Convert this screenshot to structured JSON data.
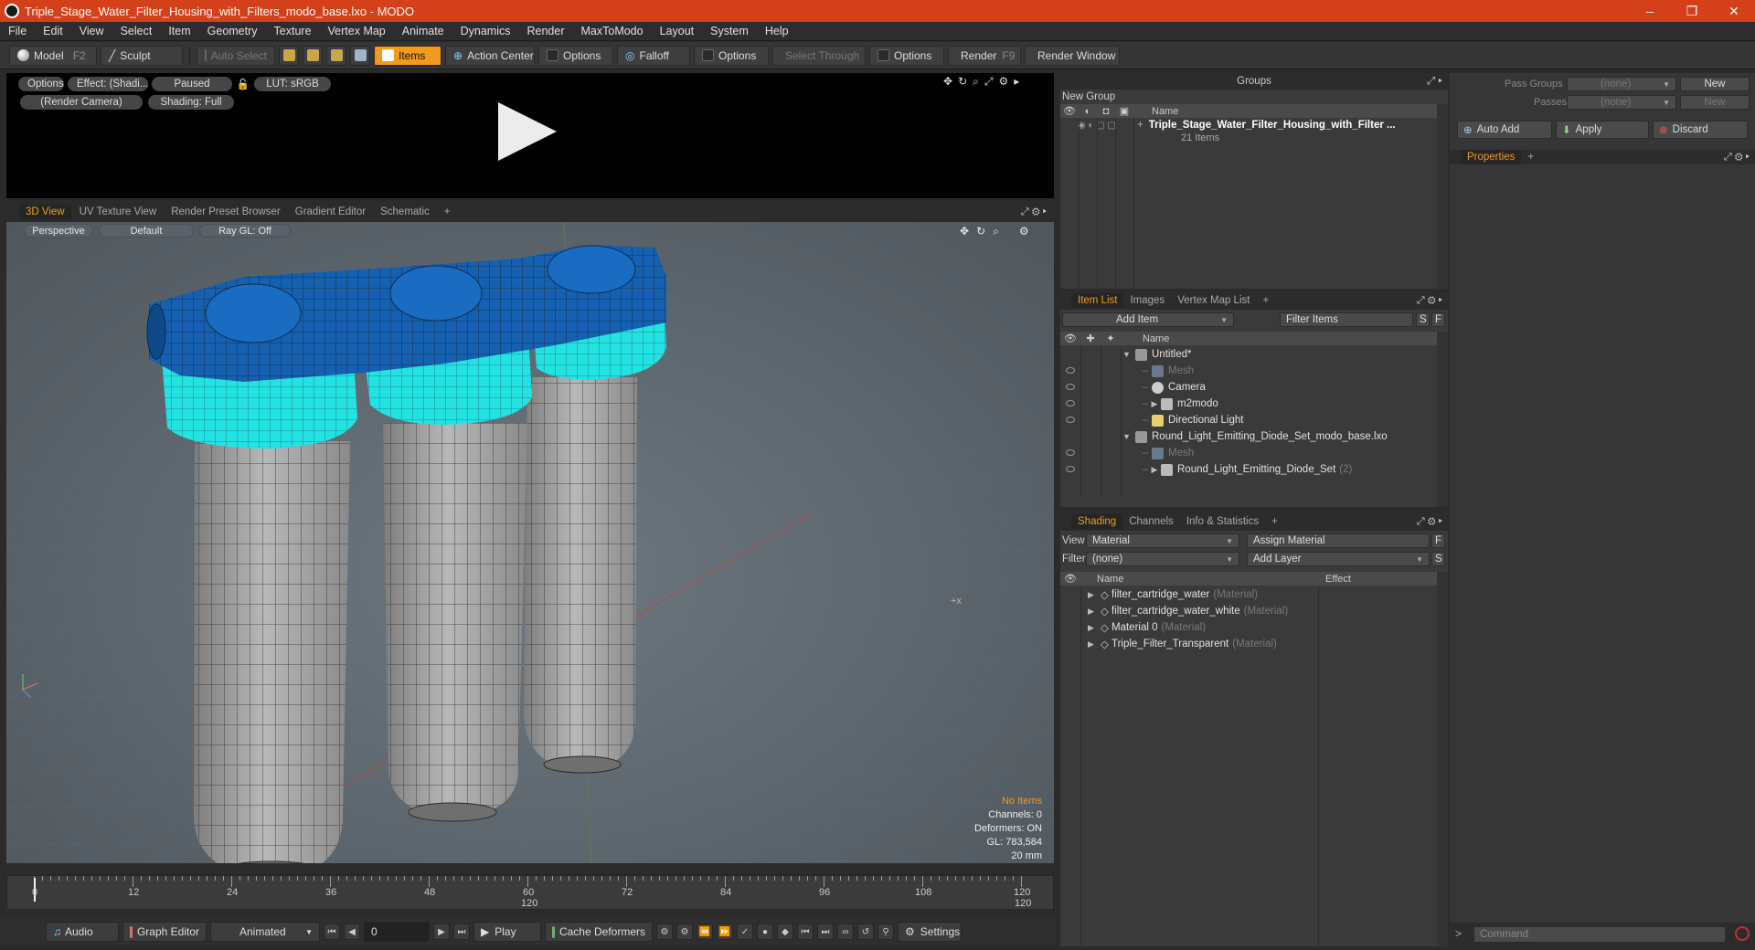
{
  "window": {
    "title": "Triple_Stage_Water_Filter_Housing_with_Filters_modo_base.lxo - MODO",
    "minimize": "–",
    "restore": "❐",
    "close": "✕"
  },
  "menu": [
    "File",
    "Edit",
    "View",
    "Select",
    "Item",
    "Geometry",
    "Texture",
    "Vertex Map",
    "Animate",
    "Dynamics",
    "Render",
    "MaxToModo",
    "Layout",
    "System",
    "Help"
  ],
  "toolbar": {
    "model": "Model",
    "model_key": "F2",
    "sculpt": "Sculpt",
    "auto_select": "Auto Select",
    "items": "Items",
    "action_center": "Action Center",
    "options1": "Options",
    "falloff": "Falloff",
    "options2": "Options",
    "select_through": "Select Through",
    "options3": "Options",
    "render": "Render",
    "render_key": "F9",
    "render_window": "Render Window"
  },
  "preview": {
    "options": "Options",
    "effect": "Effect: (Shadi...",
    "paused": "Paused",
    "lut": "LUT: sRGB",
    "camera": "(Render Camera)",
    "shading": "Shading: Full"
  },
  "viewport_tabs": [
    "3D View",
    "UV Texture View",
    "Render Preset Browser",
    "Gradient Editor",
    "Schematic",
    "+"
  ],
  "viewport": {
    "perspective": "Perspective",
    "default": "Default",
    "raygl": "Ray GL: Off",
    "axis_mark": "+x"
  },
  "stats": {
    "no_items": "No Items",
    "channels": "Channels: 0",
    "deformers": "Deformers: ON",
    "gl": "GL: 783,584",
    "scale": "20 mm"
  },
  "timeline": {
    "ticks": [
      "0",
      "12",
      "24",
      "36",
      "48",
      "60",
      "72",
      "84",
      "96",
      "108",
      "120"
    ],
    "mid": "120",
    "end": "120"
  },
  "bottom": {
    "audio": "Audio",
    "graph_editor": "Graph Editor",
    "animated": "Animated",
    "frame": "0",
    "play": "Play",
    "cache": "Cache Deformers",
    "settings": "Settings"
  },
  "groups": {
    "title": "Groups",
    "new_group": "New Group",
    "name_col": "Name",
    "item_name": "Triple_Stage_Water_Filter_Housing_with_Filter ...",
    "item_count": "21 Items"
  },
  "item_list": {
    "tabs": [
      "Item List",
      "Images",
      "Vertex Map List",
      "+"
    ],
    "add_item": "Add Item",
    "filter": "Filter Items",
    "s": "S",
    "f": "F",
    "name_col": "Name",
    "rows": [
      {
        "label": "Untitled*",
        "indent": 0,
        "arrow": "▼",
        "dim": false
      },
      {
        "label": "Mesh",
        "indent": 1,
        "arrow": "",
        "dim": true
      },
      {
        "label": "Camera",
        "indent": 1,
        "arrow": "",
        "dim": false
      },
      {
        "label": "m2modo",
        "indent": 1,
        "arrow": "▶",
        "dim": false
      },
      {
        "label": "Directional Light",
        "indent": 1,
        "arrow": "",
        "dim": false
      },
      {
        "label": "Round_Light_Emitting_Diode_Set_modo_base.lxo",
        "indent": 0,
        "arrow": "▼",
        "dim": false
      },
      {
        "label": "Mesh",
        "indent": 1,
        "arrow": "",
        "dim": true
      },
      {
        "label": "Round_Light_Emitting_Diode_Set",
        "indent": 1,
        "arrow": "▶",
        "dim": false,
        "suffix": "(2)"
      }
    ]
  },
  "shading": {
    "tabs": [
      "Shading",
      "Channels",
      "Info & Statistics",
      "+"
    ],
    "view_label": "View",
    "view_value": "Material",
    "assign": "Assign Material",
    "f": "F",
    "filter_label": "Filter",
    "filter_value": "(none)",
    "add_layer": "Add Layer",
    "s": "S",
    "name_col": "Name",
    "effect_col": "Effect",
    "rows": [
      {
        "label": "filter_cartridge_water",
        "type": "(Material)"
      },
      {
        "label": "filter_cartridge_water_white",
        "type": "(Material)"
      },
      {
        "label": "Material 0",
        "type": "(Material)"
      },
      {
        "label": "Triple_Filter_Transparent",
        "type": "(Material)"
      }
    ]
  },
  "properties": {
    "pass_groups": "Pass Groups",
    "pass_groups_value": "(none)",
    "new1": "New",
    "passes": "Passes",
    "passes_value": "(none)",
    "new2": "New",
    "auto_add": "Auto Add",
    "apply": "Apply",
    "discard": "Discard",
    "tab": "Properties",
    "plus": "+",
    "command": "Command"
  },
  "colors": {
    "accent": "#f39a1c",
    "title_bar": "#d4401a",
    "cap_blue": "#1560b0",
    "ring_cyan": "#23e2e2",
    "body_gray": "#9c9c9c"
  }
}
